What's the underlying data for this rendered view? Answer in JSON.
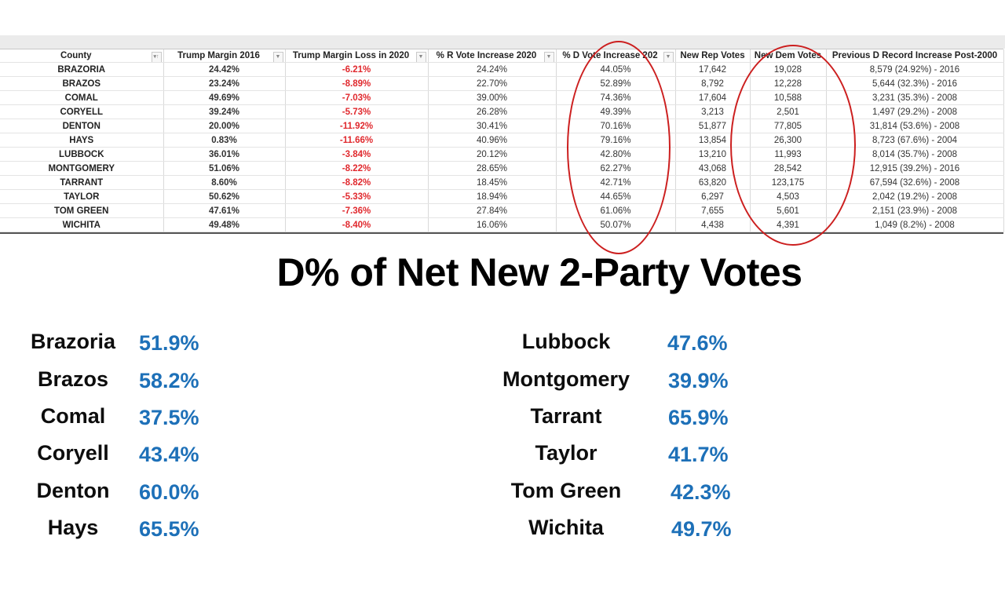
{
  "table": {
    "columns": [
      "County",
      "Trump Margin 2016",
      "Trump Margin Loss in 2020",
      "% R Vote Increase 2020",
      "% D Vote Increase 202",
      "New Rep Votes",
      "New Dem Votes",
      "Previous D Record Increase Post-2000"
    ],
    "rows": [
      [
        "BRAZORIA",
        "24.42%",
        "-6.21%",
        "24.24%",
        "44.05%",
        "17,642",
        "19,028",
        "8,579 (24.92%) - 2016"
      ],
      [
        "BRAZOS",
        "23.24%",
        "-8.89%",
        "22.70%",
        "52.89%",
        "8,792",
        "12,228",
        "5,644 (32.3%) - 2016"
      ],
      [
        "COMAL",
        "49.69%",
        "-7.03%",
        "39.00%",
        "74.36%",
        "17,604",
        "10,588",
        "3,231 (35.3%) - 2008"
      ],
      [
        "CORYELL",
        "39.24%",
        "-5.73%",
        "26.28%",
        "49.39%",
        "3,213",
        "2,501",
        "1,497 (29.2%) - 2008"
      ],
      [
        "DENTON",
        "20.00%",
        "-11.92%",
        "30.41%",
        "70.16%",
        "51,877",
        "77,805",
        "31,814 (53.6%) - 2008"
      ],
      [
        "HAYS",
        "0.83%",
        "-11.66%",
        "40.96%",
        "79.16%",
        "13,854",
        "26,300",
        "8,723 (67.6%) - 2004"
      ],
      [
        "LUBBOCK",
        "36.01%",
        "-3.84%",
        "20.12%",
        "42.80%",
        "13,210",
        "11,993",
        "8,014 (35.7%) - 2008"
      ],
      [
        "MONTGOMERY",
        "51.06%",
        "-8.22%",
        "28.65%",
        "62.27%",
        "43,068",
        "28,542",
        "12,915 (39.2%) - 2016"
      ],
      [
        "TARRANT",
        "8.60%",
        "-8.82%",
        "18.45%",
        "42.71%",
        "63,820",
        "123,175",
        "67,594 (32.6%) - 2008"
      ],
      [
        "TAYLOR",
        "50.62%",
        "-5.33%",
        "18.94%",
        "44.65%",
        "6,297",
        "4,503",
        "2,042 (19.2%) - 2008"
      ],
      [
        "TOM GREEN",
        "47.61%",
        "-7.36%",
        "27.84%",
        "61.06%",
        "7,655",
        "5,601",
        "2,151 (23.9%) - 2008"
      ],
      [
        "WICHITA",
        "49.48%",
        "-8.40%",
        "16.06%",
        "50.07%",
        "4,438",
        "4,391",
        "1,049 (8.2%) - 2008"
      ]
    ],
    "sort_icon": "sort-icon",
    "filter_icon": "filter-dropdown-icon",
    "loss_color": "#e0282d",
    "annotation_color": "#cc1f1f"
  },
  "title": "D% of Net New 2-Party Votes",
  "summary": {
    "pct_color": "#1d70b8",
    "left": [
      {
        "name": "Brazoria",
        "pct": "51.9%"
      },
      {
        "name": "Brazos",
        "pct": "58.2%"
      },
      {
        "name": "Comal",
        "pct": "37.5%"
      },
      {
        "name": "Coryell",
        "pct": "43.4%"
      },
      {
        "name": "Denton",
        "pct": "60.0%"
      },
      {
        "name": "Hays",
        "pct": "65.5%"
      }
    ],
    "right": [
      {
        "name": "Lubbock",
        "pct": "47.6%"
      },
      {
        "name": "Montgomery",
        "pct": "39.9%"
      },
      {
        "name": "Tarrant",
        "pct": "65.9%"
      },
      {
        "name": "Taylor",
        "pct": "41.7%"
      },
      {
        "name": "Tom Green",
        "pct": "42.3%"
      },
      {
        "name": "Wichita",
        "pct": "49.7%"
      }
    ]
  }
}
